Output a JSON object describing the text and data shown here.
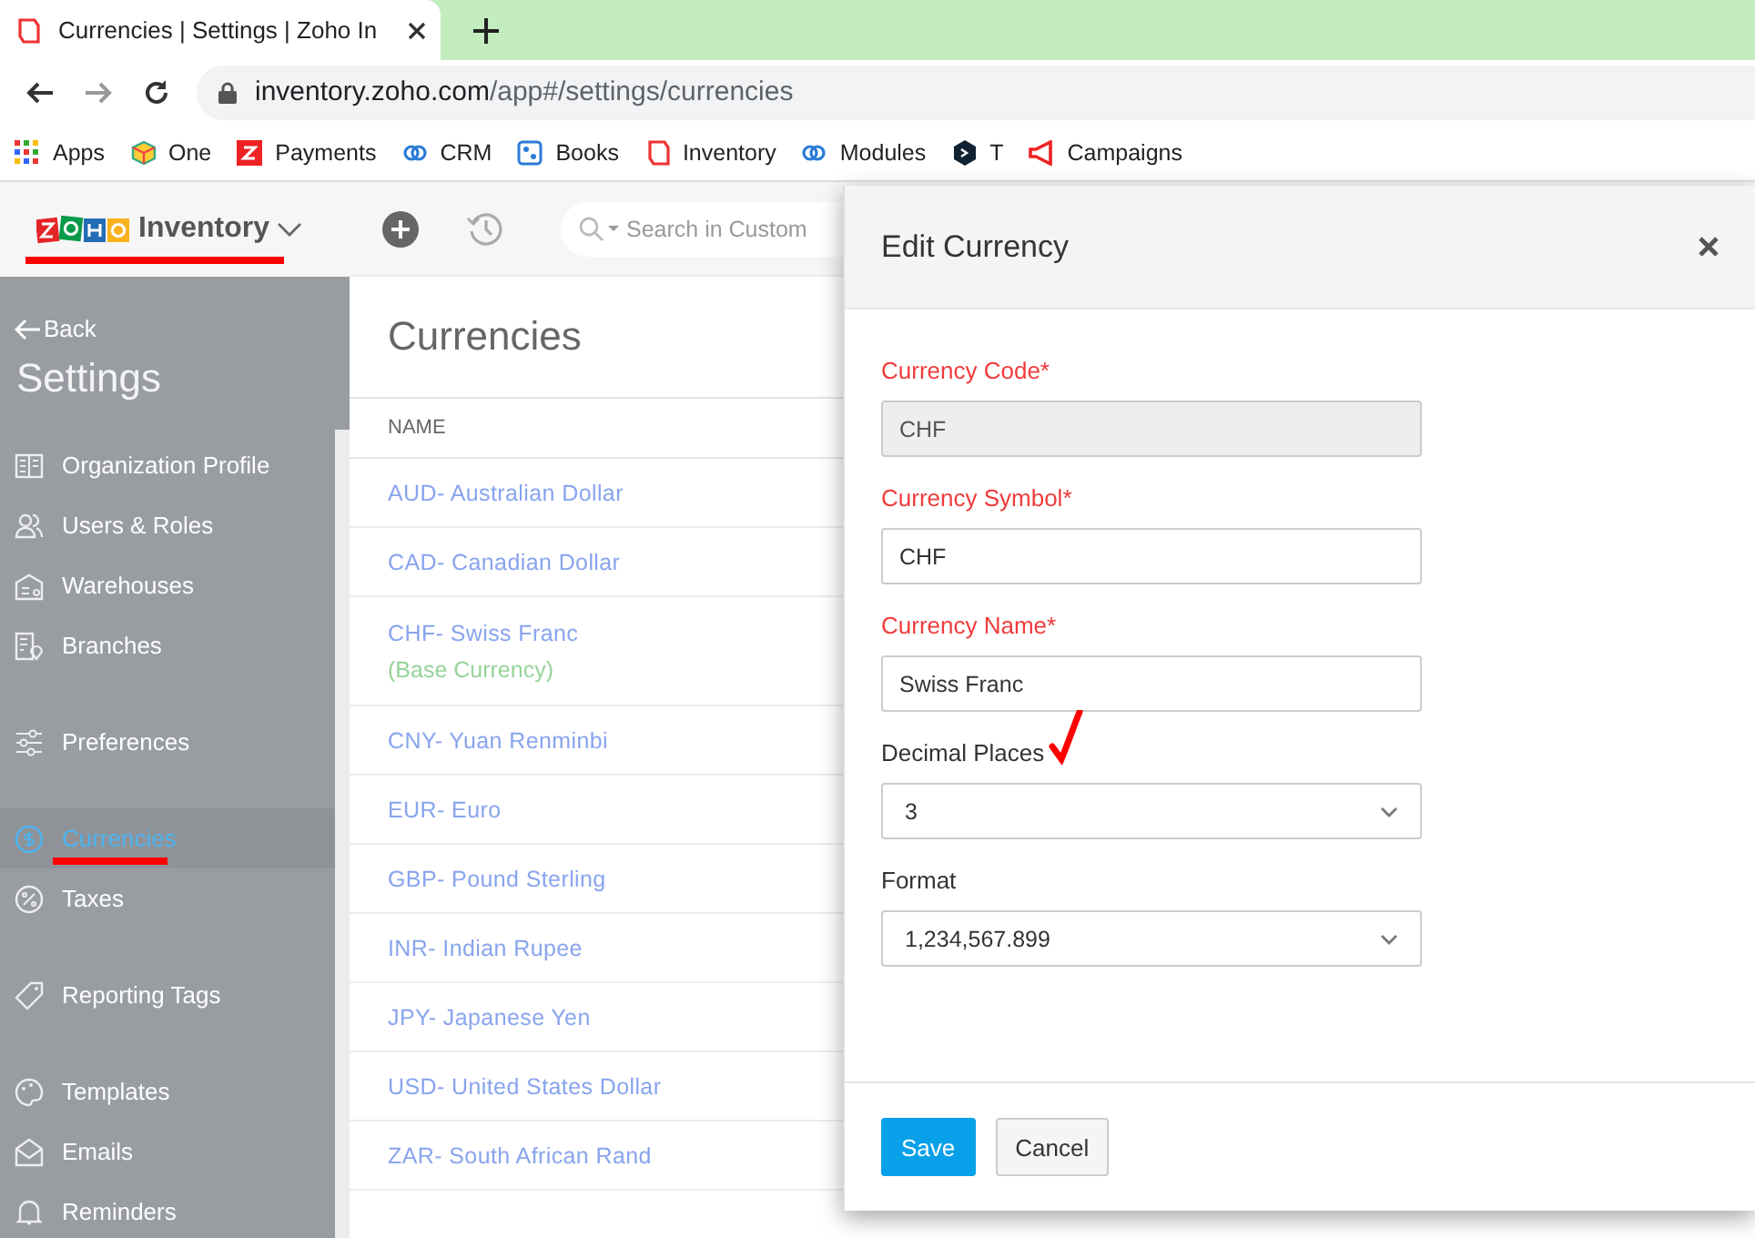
{
  "browser": {
    "tab": {
      "title": "Currencies | Settings | Zoho In",
      "selected": true
    },
    "address": {
      "host": "inventory.zoho.com",
      "path": "/app#/settings/currencies"
    },
    "bookmarks": [
      {
        "label": "Apps",
        "kind": "apps"
      },
      {
        "label": "One",
        "kind": "one"
      },
      {
        "label": "Payments",
        "kind": "payments"
      },
      {
        "label": "CRM",
        "kind": "crm"
      },
      {
        "label": "Books",
        "kind": "books"
      },
      {
        "label": "Inventory",
        "kind": "inventory"
      },
      {
        "label": "Modules",
        "kind": "crm"
      },
      {
        "label": "T",
        "kind": "t"
      },
      {
        "label": "Campaigns",
        "kind": "campaigns"
      }
    ]
  },
  "app": {
    "product": "Inventory",
    "search": {
      "placeholder": "Search in Custom"
    }
  },
  "sidebar": {
    "back": "Back",
    "title": "Settings",
    "groups": [
      [
        {
          "label": "Organization Profile",
          "selected": false
        },
        {
          "label": "Users & Roles",
          "selected": false
        },
        {
          "label": "Warehouses",
          "selected": false
        },
        {
          "label": "Branches",
          "selected": false
        }
      ],
      [
        {
          "label": "Preferences",
          "selected": false
        }
      ],
      [
        {
          "label": "Currencies",
          "selected": true
        },
        {
          "label": "Taxes",
          "selected": false
        }
      ],
      [
        {
          "label": "Reporting Tags",
          "selected": false
        }
      ],
      [
        {
          "label": "Templates",
          "selected": false
        },
        {
          "label": "Emails",
          "selected": false
        },
        {
          "label": "Reminders",
          "selected": false
        }
      ]
    ]
  },
  "page": {
    "title": "Currencies",
    "table": {
      "columns": [
        "NAME"
      ],
      "rows": [
        {
          "name": "AUD- Australian Dollar"
        },
        {
          "name": "CAD- Canadian Dollar"
        },
        {
          "name": "CHF- Swiss Franc",
          "note": "(Base Currency)"
        },
        {
          "name": "CNY- Yuan Renminbi"
        },
        {
          "name": "EUR- Euro"
        },
        {
          "name": "GBP- Pound Sterling"
        },
        {
          "name": "INR- Indian Rupee"
        },
        {
          "name": "JPY- Japanese Yen"
        },
        {
          "name": "USD- United States Dollar"
        },
        {
          "name": "ZAR- South African Rand"
        }
      ]
    }
  },
  "dialog": {
    "title": "Edit Currency",
    "fields": [
      {
        "label": "Currency Code*",
        "required": true,
        "kind": "text",
        "value": "CHF",
        "disabled": true
      },
      {
        "label": "Currency Symbol*",
        "required": true,
        "kind": "text",
        "value": "CHF",
        "disabled": false
      },
      {
        "label": "Currency Name*",
        "required": true,
        "kind": "text",
        "value": "Swiss Franc",
        "disabled": false
      },
      {
        "label": "Decimal Places",
        "required": false,
        "kind": "select",
        "value": "3",
        "disabled": false
      },
      {
        "label": "Format",
        "required": false,
        "kind": "select",
        "value": "1,234,567.899",
        "disabled": false
      }
    ],
    "buttons": [
      {
        "label": "Save",
        "kind": "primary"
      },
      {
        "label": "Cancel",
        "kind": "secondary"
      }
    ]
  }
}
